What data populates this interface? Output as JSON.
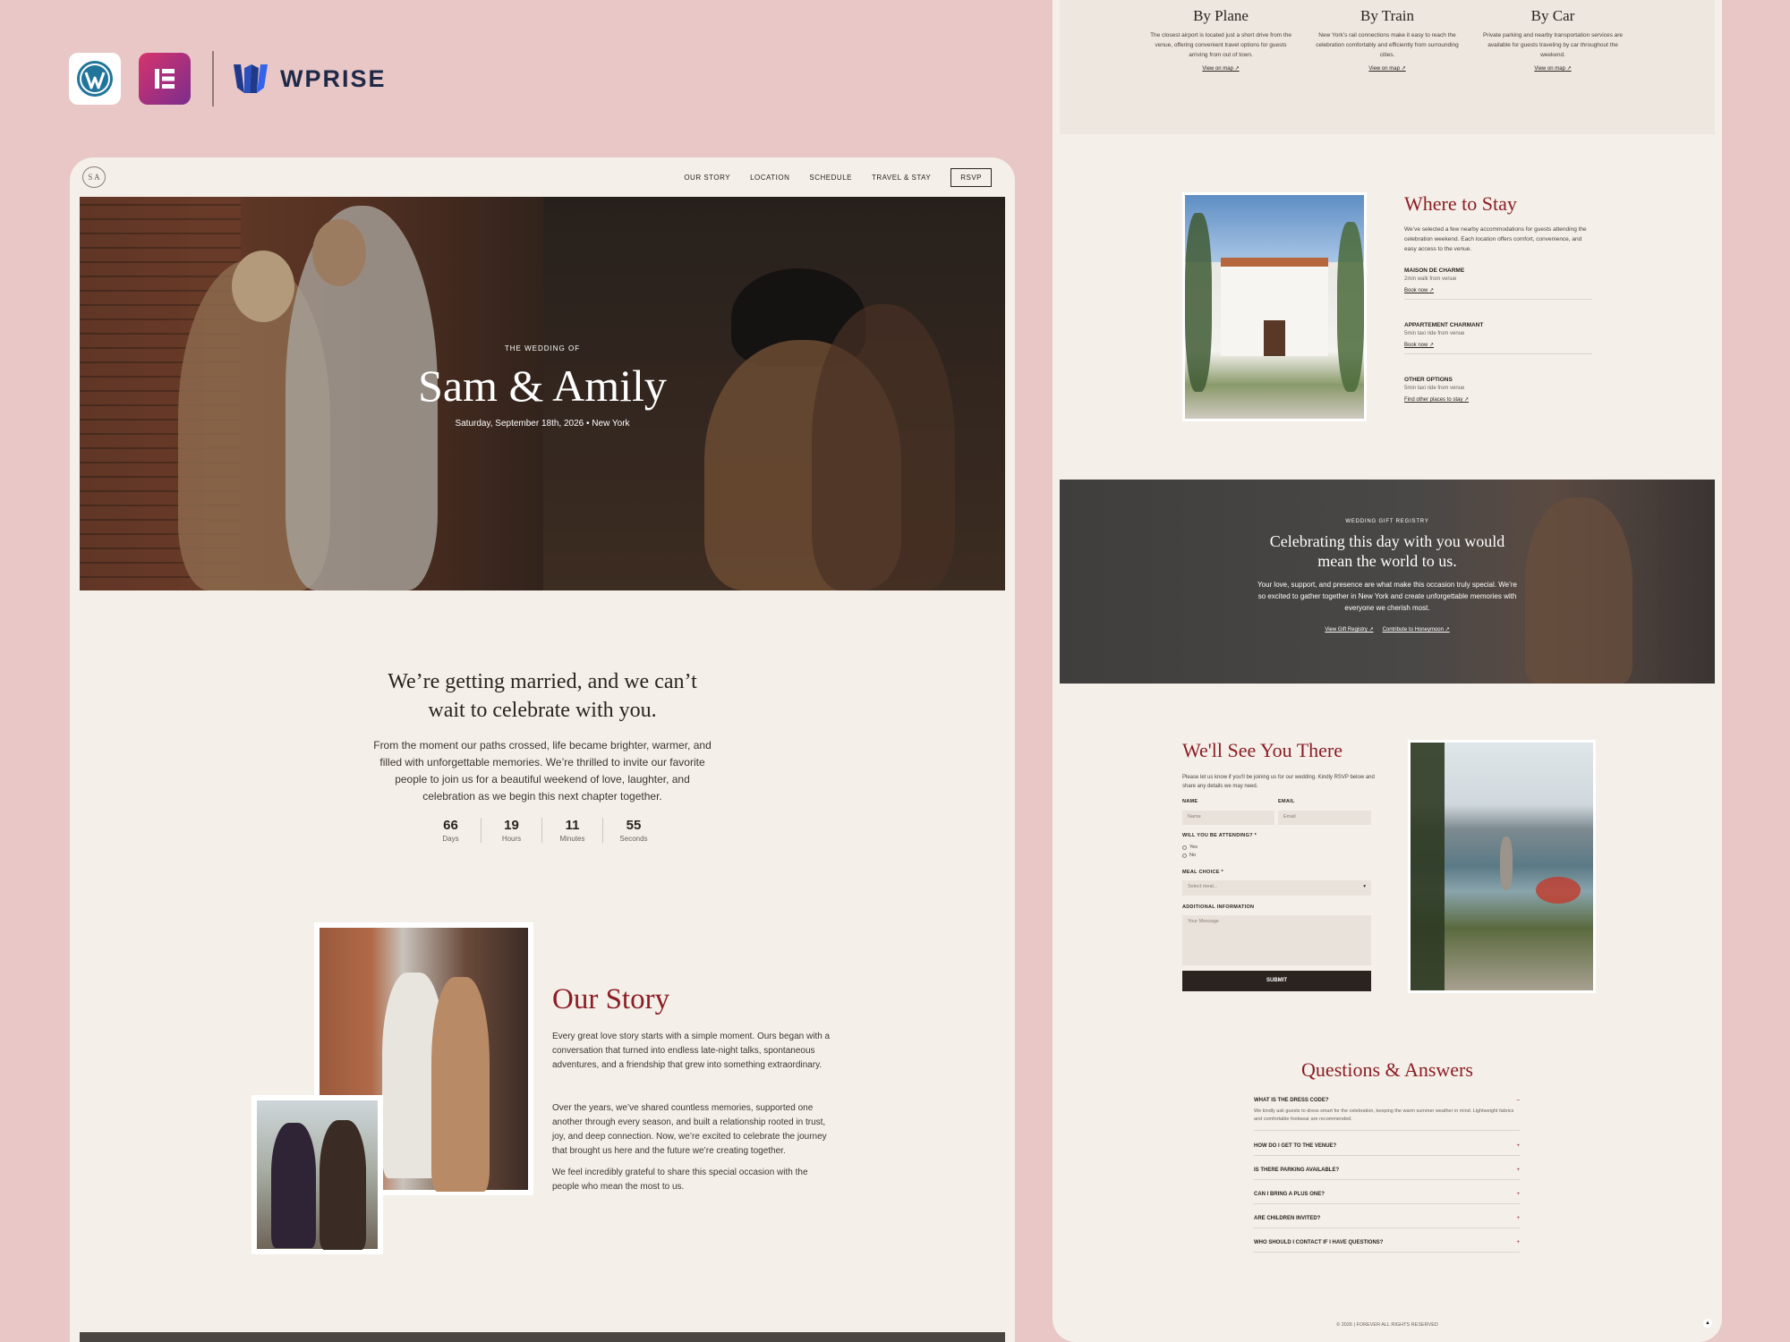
{
  "brand": {
    "wprise": "WPRISE"
  },
  "nav": {
    "logo": "S A",
    "links": [
      "OUR STORY",
      "LOCATION",
      "SCHEDULE",
      "TRAVEL & STAY"
    ],
    "rsvp": "RSVP"
  },
  "hero": {
    "kicker": "THE WEDDING OF",
    "title": "Sam & Amily",
    "date": "Saturday, September 18th, 2026 • New York"
  },
  "intro": {
    "heading_line1": "We’re getting married, and we can’t",
    "heading_line2": "wait to celebrate with you.",
    "body": "From the moment our paths crossed, life became brighter, warmer, and filled with unforgettable memories. We’re thrilled to invite our favorite people to join us for a beautiful weekend of love, laughter, and celebration as we begin this next chapter together.",
    "countdown": [
      {
        "value": "66",
        "label": "Days"
      },
      {
        "value": "19",
        "label": "Hours"
      },
      {
        "value": "11",
        "label": "Minutes"
      },
      {
        "value": "55",
        "label": "Seconds"
      }
    ]
  },
  "story": {
    "heading": "Our Story",
    "p1": "Every great love story starts with a simple moment. Ours began with a conversation that turned into endless late-night talks, spontaneous adventures, and a friendship that grew into something extraordinary.",
    "p2": "Over the years, we’ve shared countless memories, supported one another through every season, and built a relationship rooted in trust, joy, and deep connection. Now, we’re excited to celebrate the journey that brought us here and the future we’re creating together.",
    "p3": "We feel incredibly grateful to share this special occasion with the people who mean the most to us."
  },
  "travel": [
    {
      "title": "By Plane",
      "text": "The closest airport is located just a short drive from the venue, offering convenient travel options for guests arriving from out of town.",
      "link": "View on map ↗"
    },
    {
      "title": "By Train",
      "text": "New York’s rail connections make it easy to reach the celebration comfortably and efficiently from surrounding cities.",
      "link": "View on map ↗"
    },
    {
      "title": "By Car",
      "text": "Private parking and nearby transportation services are available for guests traveling by car throughout the weekend.",
      "link": "View on map ↗"
    }
  ],
  "stay": {
    "heading": "Where to Stay",
    "intro": "We’ve selected a few nearby accommodations for guests attending the celebration weekend. Each location offers comfort, convenience, and easy access to the venue.",
    "items": [
      {
        "name": "MAISON DE CHARME",
        "sub": "2min walk from venue",
        "link": "Book now ↗"
      },
      {
        "name": "APPARTEMENT CHARMANT",
        "sub": "5min taxi ride from venue",
        "link": "Book now ↗"
      },
      {
        "name": "OTHER OPTIONS",
        "sub": "5min taxi ride from venue",
        "link": "Find other places to stay ↗"
      }
    ]
  },
  "gift": {
    "kicker": "WEDDING GIFT REGISTRY",
    "heading_line1": "Celebrating this day with you would",
    "heading_line2": "mean the world to us.",
    "body": "Your love, support, and presence are what make this occasion truly special. We’re so excited to gather together in New York and create unforgettable memories with everyone we cherish most.",
    "link1": "View Gift Registry ↗",
    "link2": "Contribute to Honeymoon ↗"
  },
  "rsvp": {
    "heading": "We'll See You There",
    "intro": "Please let us know if you'll be joining us for our wedding. Kindly RSVP below and share any details we may need.",
    "name_label": "NAME",
    "email_label": "EMAIL",
    "name_ph": "Name",
    "email_ph": "Email",
    "attend_label": "WILL YOU BE ATTENDING? *",
    "yes": "Yes",
    "no": "No",
    "meal_label": "MEAL CHOICE *",
    "meal_value": "Select meal...",
    "info_label": "ADDITIONAL INFORMATION",
    "info_ph": "Your Message",
    "submit": "SUBMIT"
  },
  "qa": {
    "heading": "Questions & Answers",
    "first_q": "WHAT IS THE DRESS CODE?",
    "first_a": "We kindly ask guests to dress smart for the celebration, keeping the warm summer weather in mind. Lightweight fabrics and comfortable footwear are recommended.",
    "items": [
      "HOW DO I GET TO THE VENUE?",
      "IS THERE PARKING AVAILABLE?",
      "CAN I BRING A PLUS ONE?",
      "ARE CHILDREN INVITED?",
      "WHO SHOULD I CONTACT IF I HAVE QUESTIONS?"
    ]
  },
  "footer": {
    "text": "© 2026 | FOREVER ALL RIGHTS RESERVED"
  },
  "colors": {
    "background": "#e9c7c7",
    "card": "#f4f0e9",
    "accent": "#8b1d25",
    "dark": "#2a2320"
  }
}
